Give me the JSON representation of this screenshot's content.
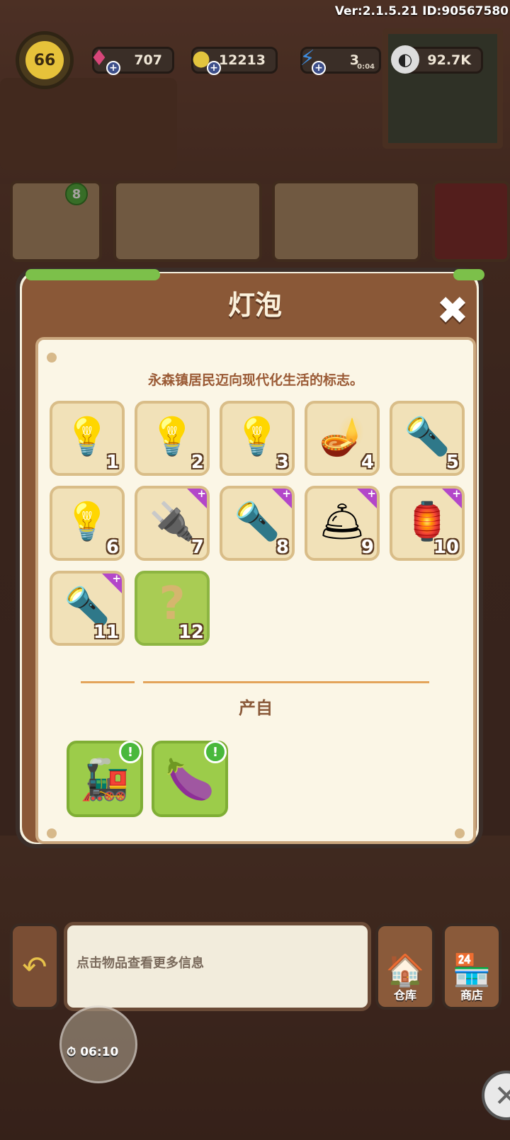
{
  "hud": {
    "version": "Ver:2.1.5.21 ID:90567580",
    "level": "66",
    "gems": "707",
    "coins": "12213",
    "energy": "3",
    "energy_timer": "0:04",
    "seeds": "92.7K",
    "icons": {
      "gem": "gem-icon",
      "coin": "coin-icon",
      "energy": "lightning-icon",
      "seed": "seed-icon"
    }
  },
  "orders": {
    "count": "8"
  },
  "modal": {
    "title": "灯泡",
    "description": "永森镇居民迈向现代化生活的标志。",
    "items": [
      {
        "num": "1",
        "icon": "candle-bulb-icon",
        "glyph": "💡",
        "locked": false
      },
      {
        "num": "2",
        "icon": "round-bulb-icon",
        "glyph": "💡",
        "locked": false
      },
      {
        "num": "3",
        "icon": "filament-bulb-icon",
        "glyph": "💡",
        "locked": false
      },
      {
        "num": "4",
        "icon": "lamp-base-bulb-icon",
        "glyph": "🪔",
        "locked": false
      },
      {
        "num": "5",
        "icon": "flashlight-icon",
        "glyph": "🔦",
        "locked": false
      },
      {
        "num": "6",
        "icon": "spiral-bulb-icon",
        "glyph": "💡",
        "locked": false
      },
      {
        "num": "7",
        "icon": "tube-light-icon",
        "glyph": "🔌",
        "locked": false,
        "premium": true
      },
      {
        "num": "8",
        "icon": "double-spotlight-icon",
        "glyph": "🔦",
        "locked": false,
        "premium": true
      },
      {
        "num": "9",
        "icon": "wall-lamp-icon",
        "glyph": "🛎",
        "locked": false,
        "premium": true
      },
      {
        "num": "10",
        "icon": "tripod-lamp-icon",
        "glyph": "🏮",
        "locked": false,
        "premium": true
      },
      {
        "num": "11",
        "icon": "stage-spotlight-icon",
        "glyph": "🔦",
        "locked": false,
        "premium": true
      },
      {
        "num": "12",
        "icon": "unknown-item-icon",
        "glyph": "?",
        "locked": true
      }
    ],
    "source_title": "产自",
    "sources": [
      {
        "icon": "train-machine-icon",
        "glyph": "🚂"
      },
      {
        "icon": "mangosteen-icon",
        "glyph": "🍆"
      }
    ]
  },
  "bottom": {
    "info_text": "点击物品查看更多信息",
    "warehouse_label": "仓库",
    "shop_label": "商店",
    "timer": "06:10"
  }
}
